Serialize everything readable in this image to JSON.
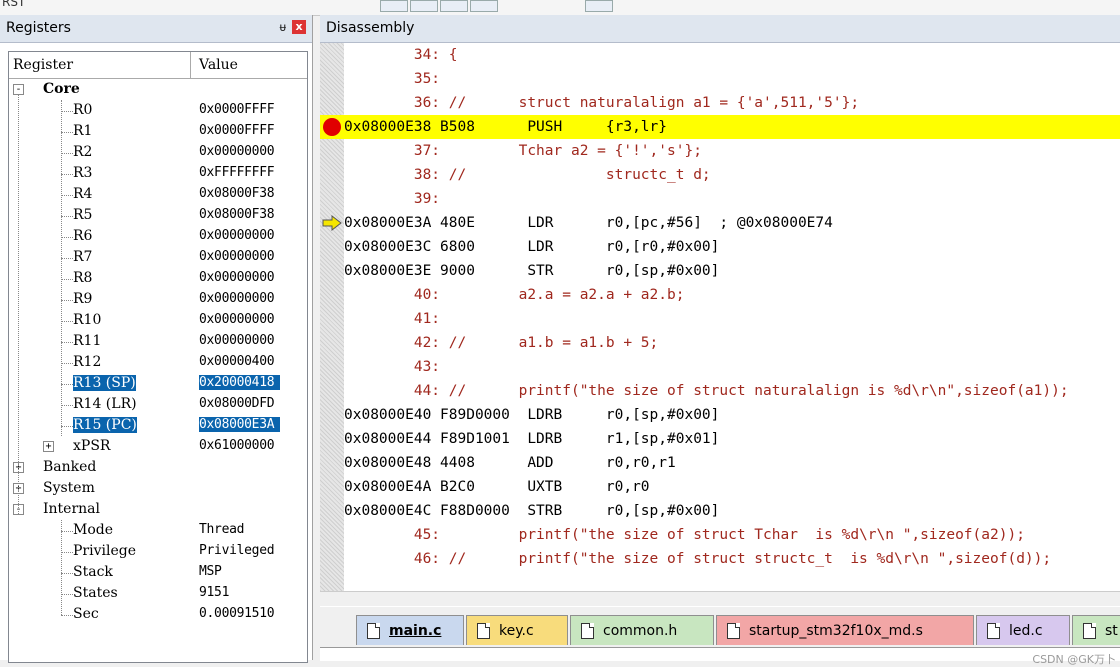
{
  "toolbar": {
    "label": "RST"
  },
  "registers": {
    "title": "Registers",
    "pin_glyph": "ᵾ",
    "close_glyph": "x",
    "columns": {
      "register": "Register",
      "value": "Value"
    },
    "core": {
      "label": "Core",
      "items": [
        {
          "name": "R0",
          "value": "0x0000FFFF"
        },
        {
          "name": "R1",
          "value": "0x0000FFFF"
        },
        {
          "name": "R2",
          "value": "0x00000000"
        },
        {
          "name": "R3",
          "value": "0xFFFFFFFF"
        },
        {
          "name": "R4",
          "value": "0x08000F38"
        },
        {
          "name": "R5",
          "value": "0x08000F38"
        },
        {
          "name": "R6",
          "value": "0x00000000"
        },
        {
          "name": "R7",
          "value": "0x00000000"
        },
        {
          "name": "R8",
          "value": "0x00000000"
        },
        {
          "name": "R9",
          "value": "0x00000000"
        },
        {
          "name": "R10",
          "value": "0x00000000"
        },
        {
          "name": "R11",
          "value": "0x00000000"
        },
        {
          "name": "R12",
          "value": "0x00000400"
        },
        {
          "name": "R13 (SP)",
          "value": "0x20000418"
        },
        {
          "name": "R14 (LR)",
          "value": "0x08000DFD"
        },
        {
          "name": "R15 (PC)",
          "value": "0x08000E3A"
        },
        {
          "name": "xPSR",
          "value": "0x61000000"
        }
      ]
    },
    "banked": "Banked",
    "system": "System",
    "internal": {
      "label": "Internal",
      "items": [
        {
          "name": "Mode",
          "value": "Thread"
        },
        {
          "name": "Privilege",
          "value": "Privileged"
        },
        {
          "name": "Stack",
          "value": "MSP"
        },
        {
          "name": "States",
          "value": "9151"
        },
        {
          "name": "Sec",
          "value": "0.00091510"
        }
      ]
    }
  },
  "disassembly": {
    "title": "Disassembly",
    "lines": [
      "        34: {",
      "        35: ",
      "        36: //      struct naturalalign a1 = {'a',511,'5'};",
      "0x08000E38 B508      PUSH     {r3,lr}",
      "        37:         Tchar a2 = {'!','s'};",
      "        38: //                structc_t d;",
      "        39: ",
      "0x08000E3A 480E      LDR      r0,[pc,#56]  ; @0x08000E74",
      "0x08000E3C 6800      LDR      r0,[r0,#0x00]",
      "0x08000E3E 9000      STR      r0,[sp,#0x00]",
      "        40:         a2.a = a2.a + a2.b;",
      "        41: ",
      "        42: //      a1.b = a1.b + 5;",
      "        43: ",
      "        44: //      printf(\"the size of struct naturalalign is %d\\r\\n\",sizeof(a1));",
      "0x08000E40 F89D0000  LDRB     r0,[sp,#0x00]",
      "0x08000E44 F89D1001  LDRB     r1,[sp,#0x01]",
      "0x08000E48 4408      ADD      r0,r0,r1",
      "0x08000E4A B2C0      UXTB     r0,r0",
      "0x08000E4C F88D0000  STRB     r0,[sp,#0x00]",
      "        45:         printf(\"the size of struct Tchar  is %d\\r\\n \",sizeof(a2));",
      "        46: //      printf(\"the size of struct structc_t  is %d\\r\\n \",sizeof(d));"
    ],
    "line_kinds": [
      "src",
      "src",
      "src",
      "asm",
      "src",
      "src",
      "src",
      "asm",
      "asm",
      "asm",
      "src",
      "src",
      "src",
      "src",
      "src",
      "asm",
      "asm",
      "asm",
      "asm",
      "asm",
      "src",
      "src"
    ]
  },
  "tabs": {
    "items": [
      {
        "label": "main.c",
        "color": "#c9d8ee"
      },
      {
        "label": "key.c",
        "color": "#f8dc7c"
      },
      {
        "label": "common.h",
        "color": "#c8e6c0"
      },
      {
        "label": "startup_stm32f10x_md.s",
        "color": "#f2a6a6"
      },
      {
        "label": "led.c",
        "color": "#d7c8ee"
      },
      {
        "label": "st",
        "color": "#c8e6c0"
      }
    ],
    "active": "main.c"
  },
  "watermark": "CSDN @GK万卜",
  "colors": {
    "selection": "#0a64ad",
    "highlight": "#ffff00",
    "source_text": "#a0281e",
    "breakpoint": "#e00000",
    "pc_arrow": "#f5e600"
  }
}
